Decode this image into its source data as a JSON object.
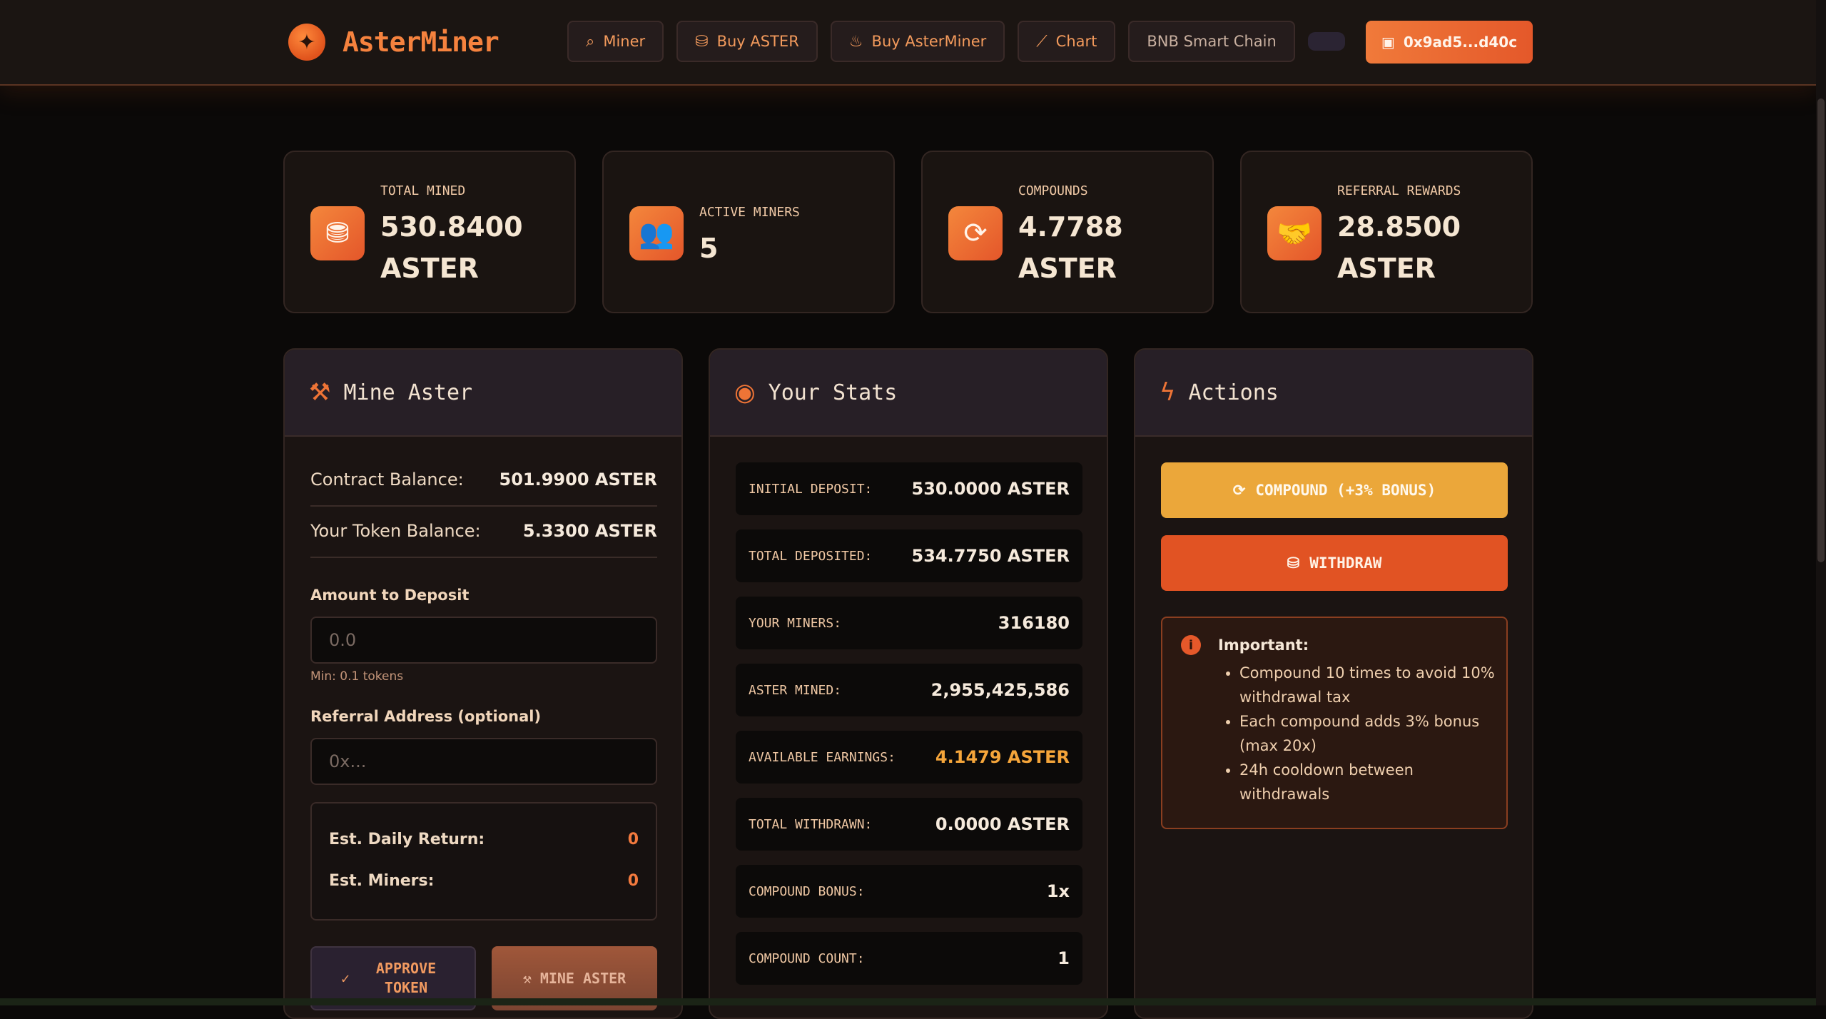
{
  "brand": {
    "name": "AsterMiner",
    "logo_icon": "star-burst-icon"
  },
  "nav": {
    "miner": "Miner",
    "buy_aster": "Buy ASTER",
    "buy_asterminer": "Buy AsterMiner",
    "chart": "Chart",
    "chain": "BNB Smart Chain",
    "wallet": "0x9ad5...d40c"
  },
  "stats": {
    "total_mined": {
      "label": "Total Mined",
      "value": "530.8400",
      "unit": "ASTER"
    },
    "active_miners": {
      "label": "Active Miners",
      "value": "5"
    },
    "compounds": {
      "label": "Compounds",
      "value": "4.7788",
      "unit": "ASTER"
    },
    "referral": {
      "label": "Referral Rewards",
      "value": "28.8500",
      "unit": "ASTER"
    }
  },
  "mine": {
    "title": "Mine Aster",
    "contract_balance_label": "Contract Balance:",
    "contract_balance_value": "501.9900 ASTER",
    "token_balance_label": "Your Token Balance:",
    "token_balance_value": "5.3300 ASTER",
    "amount_label": "Amount to Deposit",
    "amount_placeholder": "0.0",
    "min_hint": "Min: 0.1 tokens",
    "referral_label": "Referral Address (optional)",
    "referral_placeholder": "0x...",
    "est_daily_label": "Est. Daily Return:",
    "est_daily_value": "0",
    "est_miners_label": "Est. Miners:",
    "est_miners_value": "0",
    "approve_label": "APPROVE TOKEN",
    "mine_label": "MINE ASTER"
  },
  "your_stats": {
    "title": "Your Stats",
    "rows": [
      {
        "label": "Initial Deposit:",
        "value": "530.0000 ASTER"
      },
      {
        "label": "Total Deposited:",
        "value": "534.7750 ASTER"
      },
      {
        "label": "Your Miners:",
        "value": "316180"
      },
      {
        "label": "Aster Mined:",
        "value": "2,955,425,586"
      },
      {
        "label": "Available Earnings:",
        "value": "4.1479 ASTER"
      },
      {
        "label": "Total Withdrawn:",
        "value": "0.0000 ASTER"
      },
      {
        "label": "Compound Bonus:",
        "value": "1x"
      },
      {
        "label": "Compound Count:",
        "value": "1"
      }
    ]
  },
  "actions": {
    "title": "Actions",
    "compound_label": "COMPOUND (+3% BONUS)",
    "withdraw_label": "WITHDRAW",
    "important_title": "Important:",
    "notes": [
      "Compound 10 times to avoid 10% withdrawal tax",
      "Each compound adds 3% bonus (max 20x)",
      "24h cooldown between withdrawals"
    ]
  },
  "colors": {
    "accent": "#f07a3a",
    "compound": "#eba73a",
    "withdraw": "#e15323",
    "background": "#0b0908"
  }
}
